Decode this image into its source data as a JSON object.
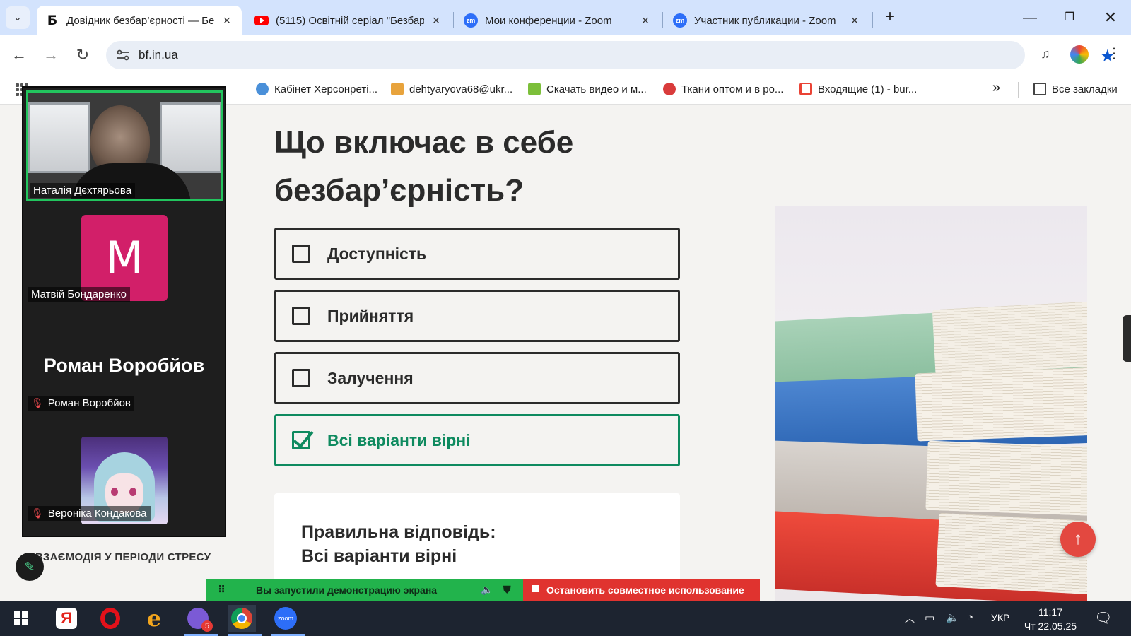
{
  "tabs": [
    {
      "title": "Довідник безбар’єрності — Бе",
      "favicon": "letter-b-icon",
      "active": true
    },
    {
      "title": "(5115) Освітній серіал \"Безбар",
      "favicon": "youtube-icon",
      "active": false
    },
    {
      "title": "Мои конференции - Zoom",
      "favicon": "zoom-icon",
      "active": false
    },
    {
      "title": "Участник публикации - Zoom",
      "favicon": "zoom-icon",
      "active": false
    }
  ],
  "favicon_letter": "Б",
  "zoom_favicon_text": "zm",
  "address": {
    "url": "bf.in.ua"
  },
  "bookmarks": {
    "items": [
      {
        "label": "Кабінет Херсонреті...",
        "color": "#4a90d9"
      },
      {
        "label": "dehtyaryova68@ukr...",
        "color": "#e8a33c"
      },
      {
        "label": "Скачать видео и м...",
        "color": "#7cbf3a"
      },
      {
        "label": "Ткани оптом и в ро...",
        "color": "#d93b3b"
      },
      {
        "label": "Входящие (1) - bur...",
        "color": "#ea4335"
      }
    ],
    "more": "»",
    "all": "Все закладки"
  },
  "zoom": {
    "participants": [
      {
        "name": "Наталія Дєхтярьова",
        "kind": "video"
      },
      {
        "name": "Матвій Бондаренко",
        "kind": "avatar",
        "initial": "M",
        "color": "#d21f69"
      },
      {
        "name": "Роман Воробйов",
        "kind": "name",
        "display": "Роман Воробйов",
        "muted": true
      },
      {
        "name": "Вероніка Кондакова",
        "kind": "image",
        "muted": true
      }
    ]
  },
  "quiz": {
    "question": "Що включає в себе безбар’єрність?",
    "options": [
      {
        "label": "Доступність",
        "checked": false
      },
      {
        "label": "Прийняття",
        "checked": false
      },
      {
        "label": "Залучення",
        "checked": false
      },
      {
        "label": "Всі варіанти вірні",
        "checked": true
      }
    ],
    "answer_title": "Правильна відповідь:",
    "answer_text": "Всі варіанти вірні"
  },
  "page": {
    "section_label": "ВЗАЄМОДІЯ У ПЕРІОДИ СТРЕСУ",
    "accent": "#0e8a5f",
    "up_button": "↑"
  },
  "share_bar": {
    "status": "Вы запустили демонстрацию экрана",
    "stop": "Остановить совместное использование"
  },
  "taskbar": {
    "apps": [
      "windows-start",
      "yandex-browser",
      "opera",
      "edge-legacy",
      "viber",
      "chrome",
      "zoom"
    ],
    "viber_badge": "5",
    "zoom_label": "zoom",
    "lang": "УКР",
    "time": "11:17",
    "date": "Чт 22.05.25"
  }
}
